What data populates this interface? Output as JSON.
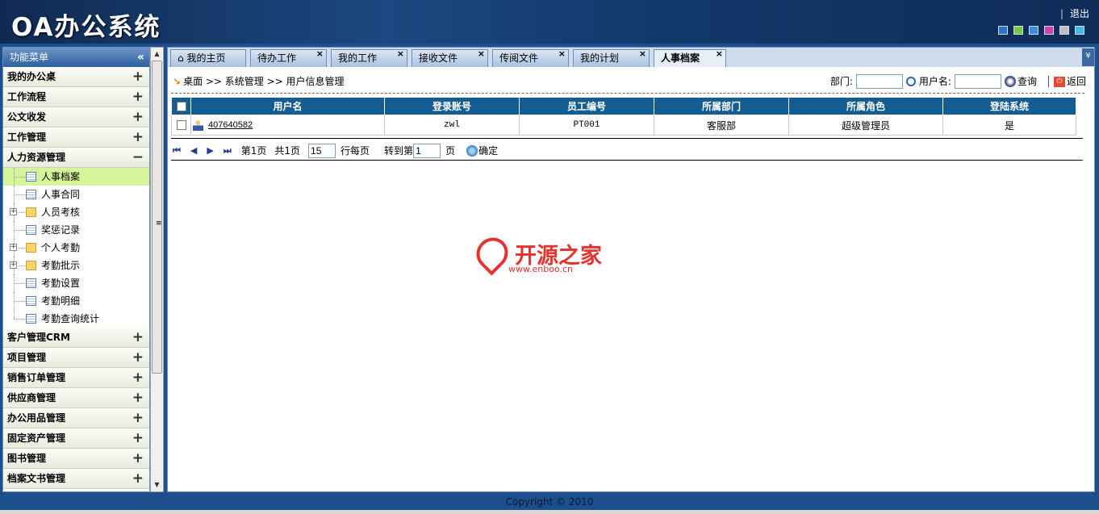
{
  "app": {
    "title": "OA办公系统",
    "logout": "退出",
    "separator": "|"
  },
  "swatch_colors": [
    "#2a74cc",
    "#7bc83a",
    "#3c8de0",
    "#d23fae",
    "#bdbdbd",
    "#49b6e6"
  ],
  "sidebar": {
    "title": "功能菜单",
    "collapse": "«",
    "sections_top": [
      {
        "label": "我的办公桌",
        "sign": "+"
      },
      {
        "label": "工作流程",
        "sign": "+"
      },
      {
        "label": "公文收发",
        "sign": "+"
      },
      {
        "label": "工作管理",
        "sign": "+"
      },
      {
        "label": "人力资源管理",
        "sign": "−"
      }
    ],
    "tree": [
      {
        "label": "人事档案",
        "icon": "doc",
        "expand": ""
      },
      {
        "label": "人事合同",
        "icon": "doc",
        "expand": ""
      },
      {
        "label": "人员考核",
        "icon": "folder",
        "expand": "+"
      },
      {
        "label": "奖惩记录",
        "icon": "doc",
        "expand": ""
      },
      {
        "label": "个人考勤",
        "icon": "folder",
        "expand": "+"
      },
      {
        "label": "考勤批示",
        "icon": "folder",
        "expand": "+"
      },
      {
        "label": "考勤设置",
        "icon": "doc",
        "expand": ""
      },
      {
        "label": "考勤明细",
        "icon": "doc",
        "expand": ""
      },
      {
        "label": "考勤查询统计",
        "icon": "doc",
        "expand": ""
      }
    ],
    "sections_bottom": [
      {
        "label": "客户管理CRM",
        "sign": "+"
      },
      {
        "label": "项目管理",
        "sign": "+"
      },
      {
        "label": "销售订单管理",
        "sign": "+"
      },
      {
        "label": "供应商管理",
        "sign": "+"
      },
      {
        "label": "办公用品管理",
        "sign": "+"
      },
      {
        "label": "固定资产管理",
        "sign": "+"
      },
      {
        "label": "图书管理",
        "sign": "+"
      },
      {
        "label": "档案文书管理",
        "sign": "+"
      }
    ]
  },
  "tabs": [
    {
      "label": "我的主页",
      "close": ""
    },
    {
      "label": "待办工作",
      "close": "×"
    },
    {
      "label": "我的工作",
      "close": "×"
    },
    {
      "label": "接收文件",
      "close": "×"
    },
    {
      "label": "传阅文件",
      "close": "×"
    },
    {
      "label": "我的计划",
      "close": "×"
    },
    {
      "label": "人事档案",
      "close": "×"
    }
  ],
  "tab_dropdown": "¥",
  "breadcrumb": {
    "text": "桌面 >> 系统管理 >> 用户信息管理"
  },
  "search": {
    "dept_label": "部门:",
    "user_label": "用户名:",
    "dept_value": "",
    "user_value": "",
    "query_label": "查询",
    "back_label": "返回"
  },
  "table": {
    "headers": [
      "用户名",
      "登录账号",
      "员工编号",
      "所属部门",
      "所属角色",
      "登陆系统"
    ],
    "rows": [
      {
        "username": "407640582",
        "account": "zwl",
        "emp_no": "PT001",
        "dept": "客服部",
        "role": "超级管理员",
        "login": "是"
      }
    ]
  },
  "pager": {
    "first": "⏮",
    "prev": "◀",
    "next": "▶",
    "last": "⏭",
    "page_text": "第1页",
    "total_text": "共1页",
    "per_page": "15",
    "per_page_label": "行每页",
    "goto_label": "转到第",
    "goto_value": "1",
    "goto_suffix": "页",
    "confirm": "确定"
  },
  "watermark": {
    "title": "开源之家",
    "url": "www.enboo.cn"
  },
  "footer": "Copyright © 2010"
}
